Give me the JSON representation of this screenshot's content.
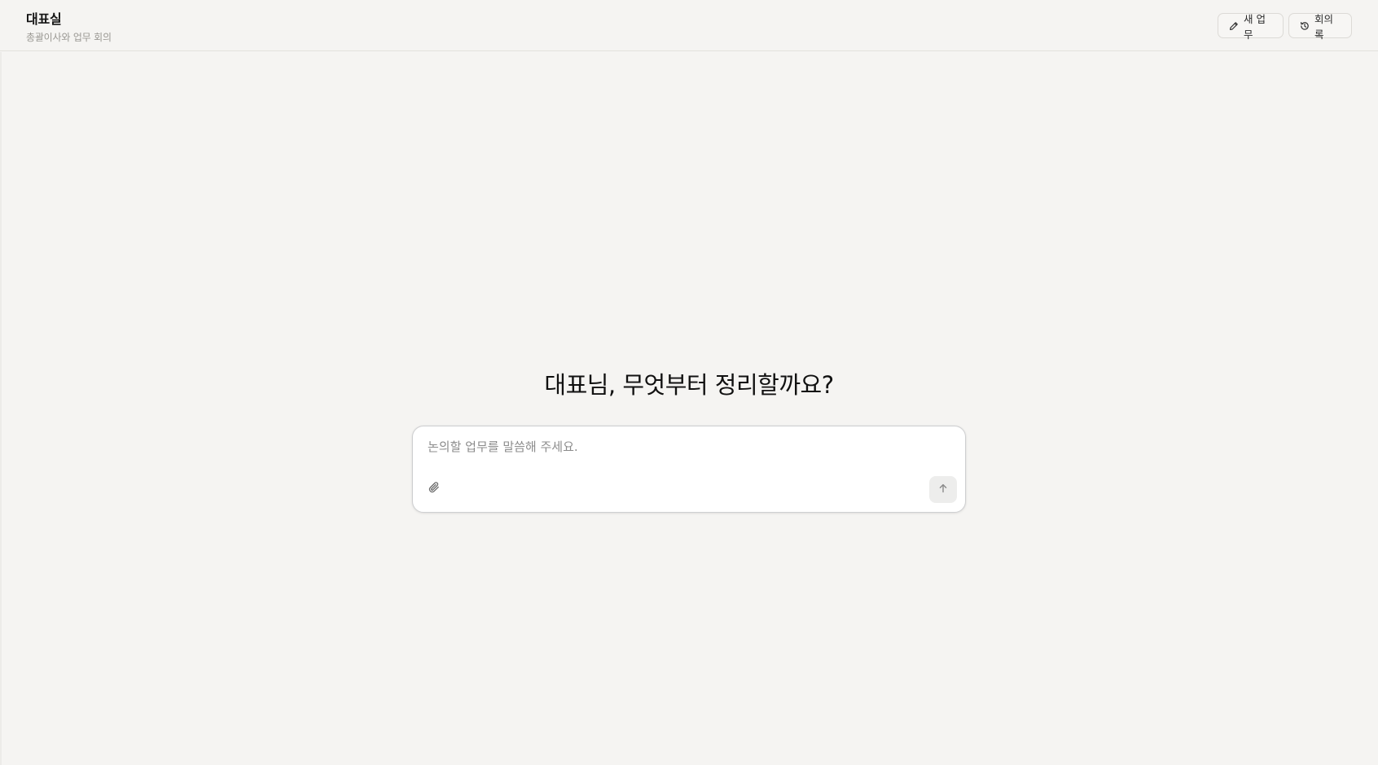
{
  "header": {
    "title": "대표실",
    "subtitle": "총괄이사와 업무 회의",
    "buttons": [
      {
        "label": "새 업무",
        "icon": "pencil-icon"
      },
      {
        "label": "회의록",
        "icon": "history-icon"
      }
    ]
  },
  "main": {
    "heading": "대표님, 무엇부터 정리할까요?",
    "composer": {
      "placeholder": "논의할 업무를 말씀해 주세요.",
      "value": "",
      "attach_icon": "paperclip-icon",
      "send_icon": "arrow-up-icon"
    }
  },
  "colors": {
    "background": "#f5f4f2",
    "composer_bg": "#ffffff",
    "send_button_bg": "#ededec"
  }
}
